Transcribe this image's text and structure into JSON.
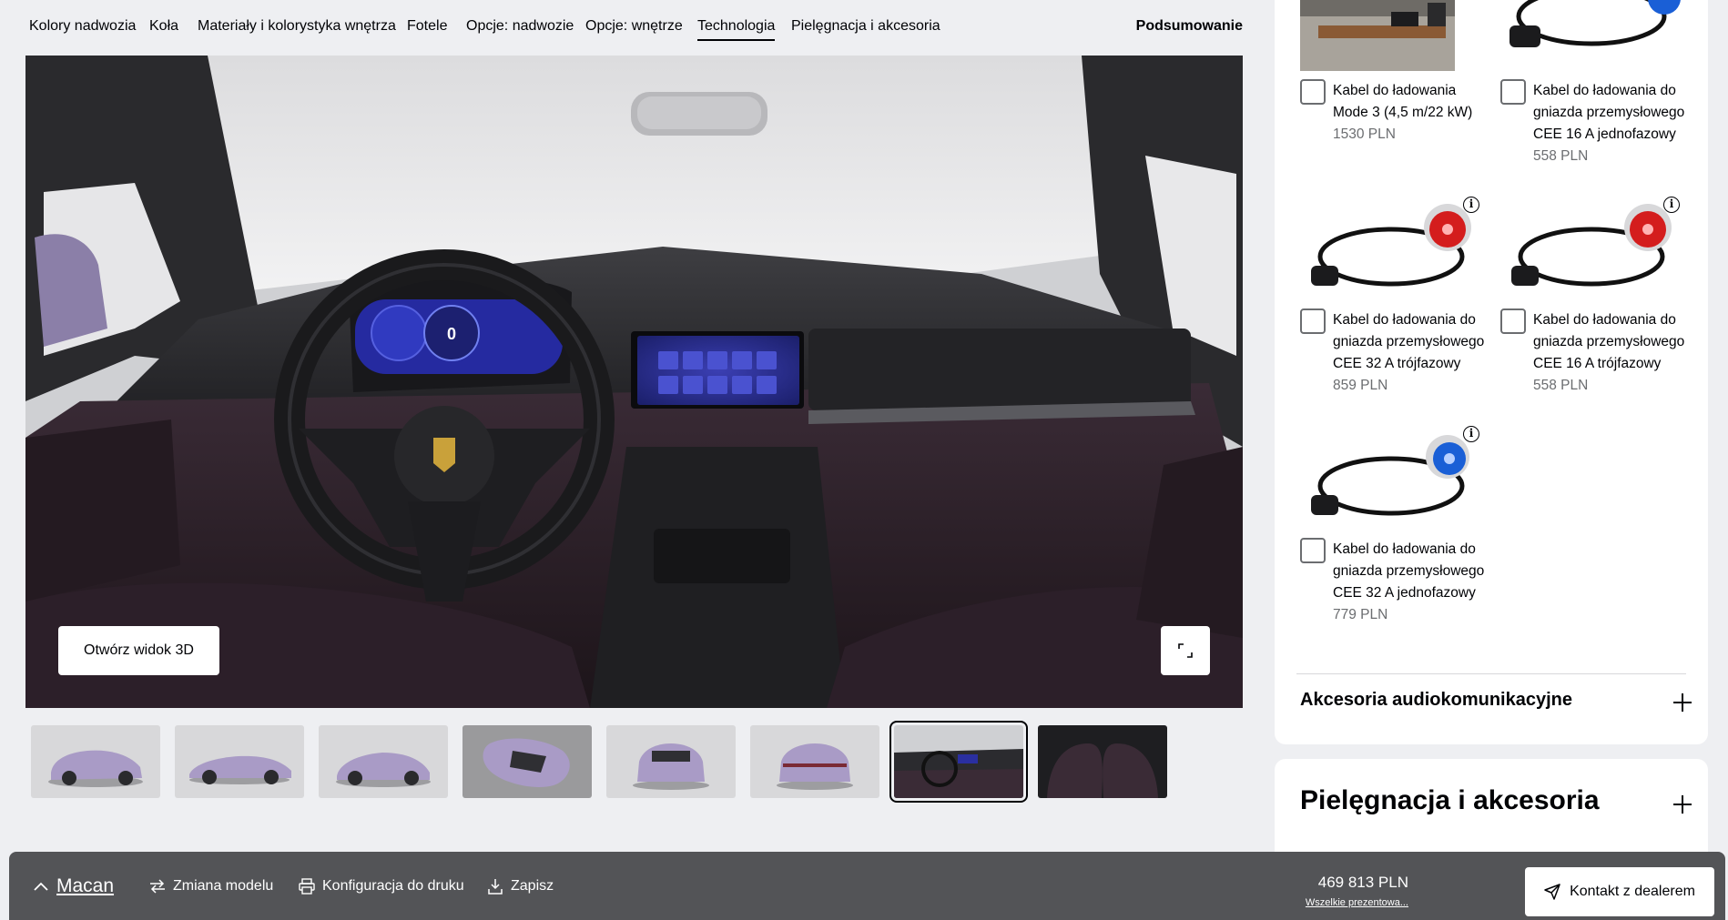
{
  "nav": {
    "items": [
      {
        "label": "Kolory nadwozia"
      },
      {
        "label": "Koła"
      },
      {
        "label": "Materiały i kolorystyka wnętrza"
      },
      {
        "label": "Fotele"
      },
      {
        "label": "Opcje: nadwozie"
      },
      {
        "label": "Opcje: wnętrze"
      },
      {
        "label": "Technologia"
      },
      {
        "label": "Pielęgnacja i akcesoria"
      }
    ],
    "active": "Technologia",
    "summary": "Podsumowanie"
  },
  "viewer": {
    "open_3d": "Otwórz widok 3D",
    "fullscreen_icon": "expand-icon",
    "cluster_speed": "0"
  },
  "thumbnails": {
    "count": 8,
    "selected_index": 6
  },
  "accessories": [
    {
      "name": "Kabel do ładowania Mode 3 (4,5 m/22 kW)",
      "price": "1530 PLN",
      "info": false
    },
    {
      "name": "Kabel do ładowania do gniazda przemysłowego CEE 16 A jednofazowy",
      "price": "558 PLN",
      "info": false
    },
    {
      "name": "Kabel do ładowania do gniazda przemysłowego CEE 32 A trójfazowy",
      "price": "859 PLN",
      "info": true
    },
    {
      "name": "Kabel do ładowania do gniazda przemysłowego CEE 16 A trójfazowy",
      "price": "558 PLN",
      "info": true
    },
    {
      "name": "Kabel do ładowania do gniazda przemysłowego CEE 32 A jednofazowy",
      "price": "779 PLN",
      "info": true
    }
  ],
  "info_glyph": "i",
  "sections": {
    "audio": "Akcesoria audiokomunikacyjne",
    "care": "Pielęgnacja i akcesoria"
  },
  "bottombar": {
    "model": "Macan",
    "change_model": "Zmiana modelu",
    "print": "Konfiguracja do druku",
    "save": "Zapisz",
    "price": "469 813 PLN",
    "price_note": "Wszelkie prezentowa...",
    "contact": "Kontakt z dealerem"
  },
  "colors": {
    "background": "#eeeff2",
    "bar": "#535457",
    "car_paint": "#a99bc6",
    "interior": "#3a2b36"
  }
}
